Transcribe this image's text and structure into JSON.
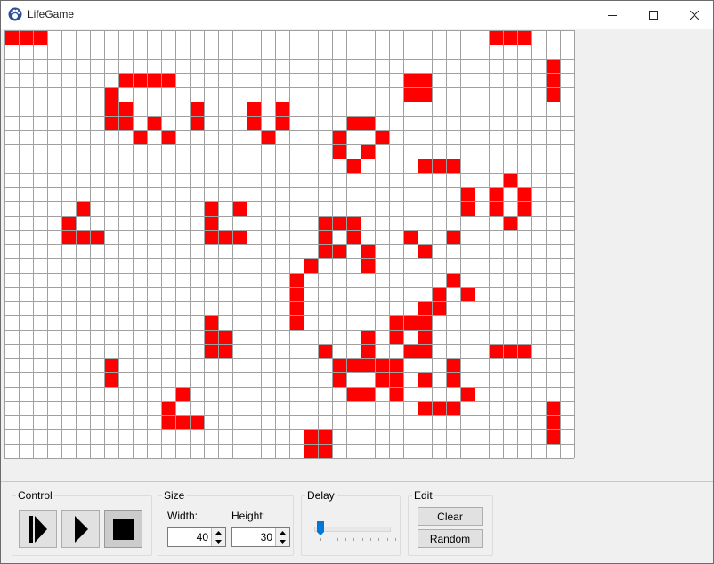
{
  "window": {
    "title": "LifeGame"
  },
  "grid": {
    "columns": 40,
    "rows": 30,
    "alive_color": "#ff0000",
    "dead_color": "#ffffff",
    "line_color": "#a0a0a0",
    "alive_cells": [
      [
        0,
        0
      ],
      [
        1,
        0
      ],
      [
        2,
        0
      ],
      [
        34,
        0
      ],
      [
        35,
        0
      ],
      [
        36,
        0
      ],
      [
        38,
        2
      ],
      [
        8,
        3
      ],
      [
        9,
        3
      ],
      [
        10,
        3
      ],
      [
        11,
        3
      ],
      [
        28,
        3
      ],
      [
        29,
        3
      ],
      [
        38,
        3
      ],
      [
        7,
        4
      ],
      [
        28,
        4
      ],
      [
        29,
        4
      ],
      [
        38,
        4
      ],
      [
        7,
        5
      ],
      [
        8,
        5
      ],
      [
        13,
        5
      ],
      [
        17,
        5
      ],
      [
        19,
        5
      ],
      [
        7,
        6
      ],
      [
        8,
        6
      ],
      [
        10,
        6
      ],
      [
        13,
        6
      ],
      [
        17,
        6
      ],
      [
        19,
        6
      ],
      [
        24,
        6
      ],
      [
        25,
        6
      ],
      [
        9,
        7
      ],
      [
        11,
        7
      ],
      [
        18,
        7
      ],
      [
        23,
        7
      ],
      [
        26,
        7
      ],
      [
        23,
        8
      ],
      [
        25,
        8
      ],
      [
        24,
        9
      ],
      [
        29,
        9
      ],
      [
        30,
        9
      ],
      [
        31,
        9
      ],
      [
        35,
        10
      ],
      [
        32,
        11
      ],
      [
        34,
        11
      ],
      [
        36,
        11
      ],
      [
        5,
        12
      ],
      [
        14,
        12
      ],
      [
        16,
        12
      ],
      [
        32,
        12
      ],
      [
        34,
        12
      ],
      [
        36,
        12
      ],
      [
        4,
        13
      ],
      [
        14,
        13
      ],
      [
        22,
        13
      ],
      [
        23,
        13
      ],
      [
        24,
        13
      ],
      [
        35,
        13
      ],
      [
        4,
        14
      ],
      [
        5,
        14
      ],
      [
        6,
        14
      ],
      [
        14,
        14
      ],
      [
        15,
        14
      ],
      [
        16,
        14
      ],
      [
        22,
        14
      ],
      [
        24,
        14
      ],
      [
        28,
        14
      ],
      [
        31,
        14
      ],
      [
        22,
        15
      ],
      [
        23,
        15
      ],
      [
        25,
        15
      ],
      [
        29,
        15
      ],
      [
        21,
        16
      ],
      [
        25,
        16
      ],
      [
        20,
        17
      ],
      [
        31,
        17
      ],
      [
        20,
        18
      ],
      [
        30,
        18
      ],
      [
        32,
        18
      ],
      [
        20,
        19
      ],
      [
        29,
        19
      ],
      [
        30,
        19
      ],
      [
        20,
        20
      ],
      [
        14,
        20
      ],
      [
        27,
        20
      ],
      [
        28,
        20
      ],
      [
        29,
        20
      ],
      [
        14,
        21
      ],
      [
        15,
        21
      ],
      [
        25,
        21
      ],
      [
        27,
        21
      ],
      [
        29,
        21
      ],
      [
        14,
        22
      ],
      [
        15,
        22
      ],
      [
        22,
        22
      ],
      [
        25,
        22
      ],
      [
        28,
        22
      ],
      [
        29,
        22
      ],
      [
        34,
        22
      ],
      [
        35,
        22
      ],
      [
        36,
        22
      ],
      [
        7,
        23
      ],
      [
        23,
        23
      ],
      [
        24,
        23
      ],
      [
        25,
        23
      ],
      [
        26,
        23
      ],
      [
        27,
        23
      ],
      [
        31,
        23
      ],
      [
        7,
        24
      ],
      [
        23,
        24
      ],
      [
        26,
        24
      ],
      [
        27,
        24
      ],
      [
        29,
        24
      ],
      [
        31,
        24
      ],
      [
        12,
        25
      ],
      [
        24,
        25
      ],
      [
        25,
        25
      ],
      [
        27,
        25
      ],
      [
        32,
        25
      ],
      [
        11,
        26
      ],
      [
        29,
        26
      ],
      [
        30,
        26
      ],
      [
        31,
        26
      ],
      [
        38,
        26
      ],
      [
        11,
        27
      ],
      [
        12,
        27
      ],
      [
        13,
        27
      ],
      [
        38,
        27
      ],
      [
        38,
        28
      ],
      [
        21,
        28
      ],
      [
        21,
        29
      ],
      [
        22,
        29
      ],
      [
        22,
        28
      ]
    ]
  },
  "control": {
    "title": "Control",
    "step_button_icon": "step-play-icon",
    "play_button_icon": "play-icon",
    "stop_button_icon": "stop-icon"
  },
  "size": {
    "title": "Size",
    "width_label": "Width:",
    "height_label": "Height:",
    "width_value": "40",
    "height_value": "30"
  },
  "delay": {
    "title": "Delay",
    "value_fraction": 0.0,
    "ticks": 10
  },
  "edit": {
    "title": "Edit",
    "clear_label": "Clear",
    "random_label": "Random"
  }
}
